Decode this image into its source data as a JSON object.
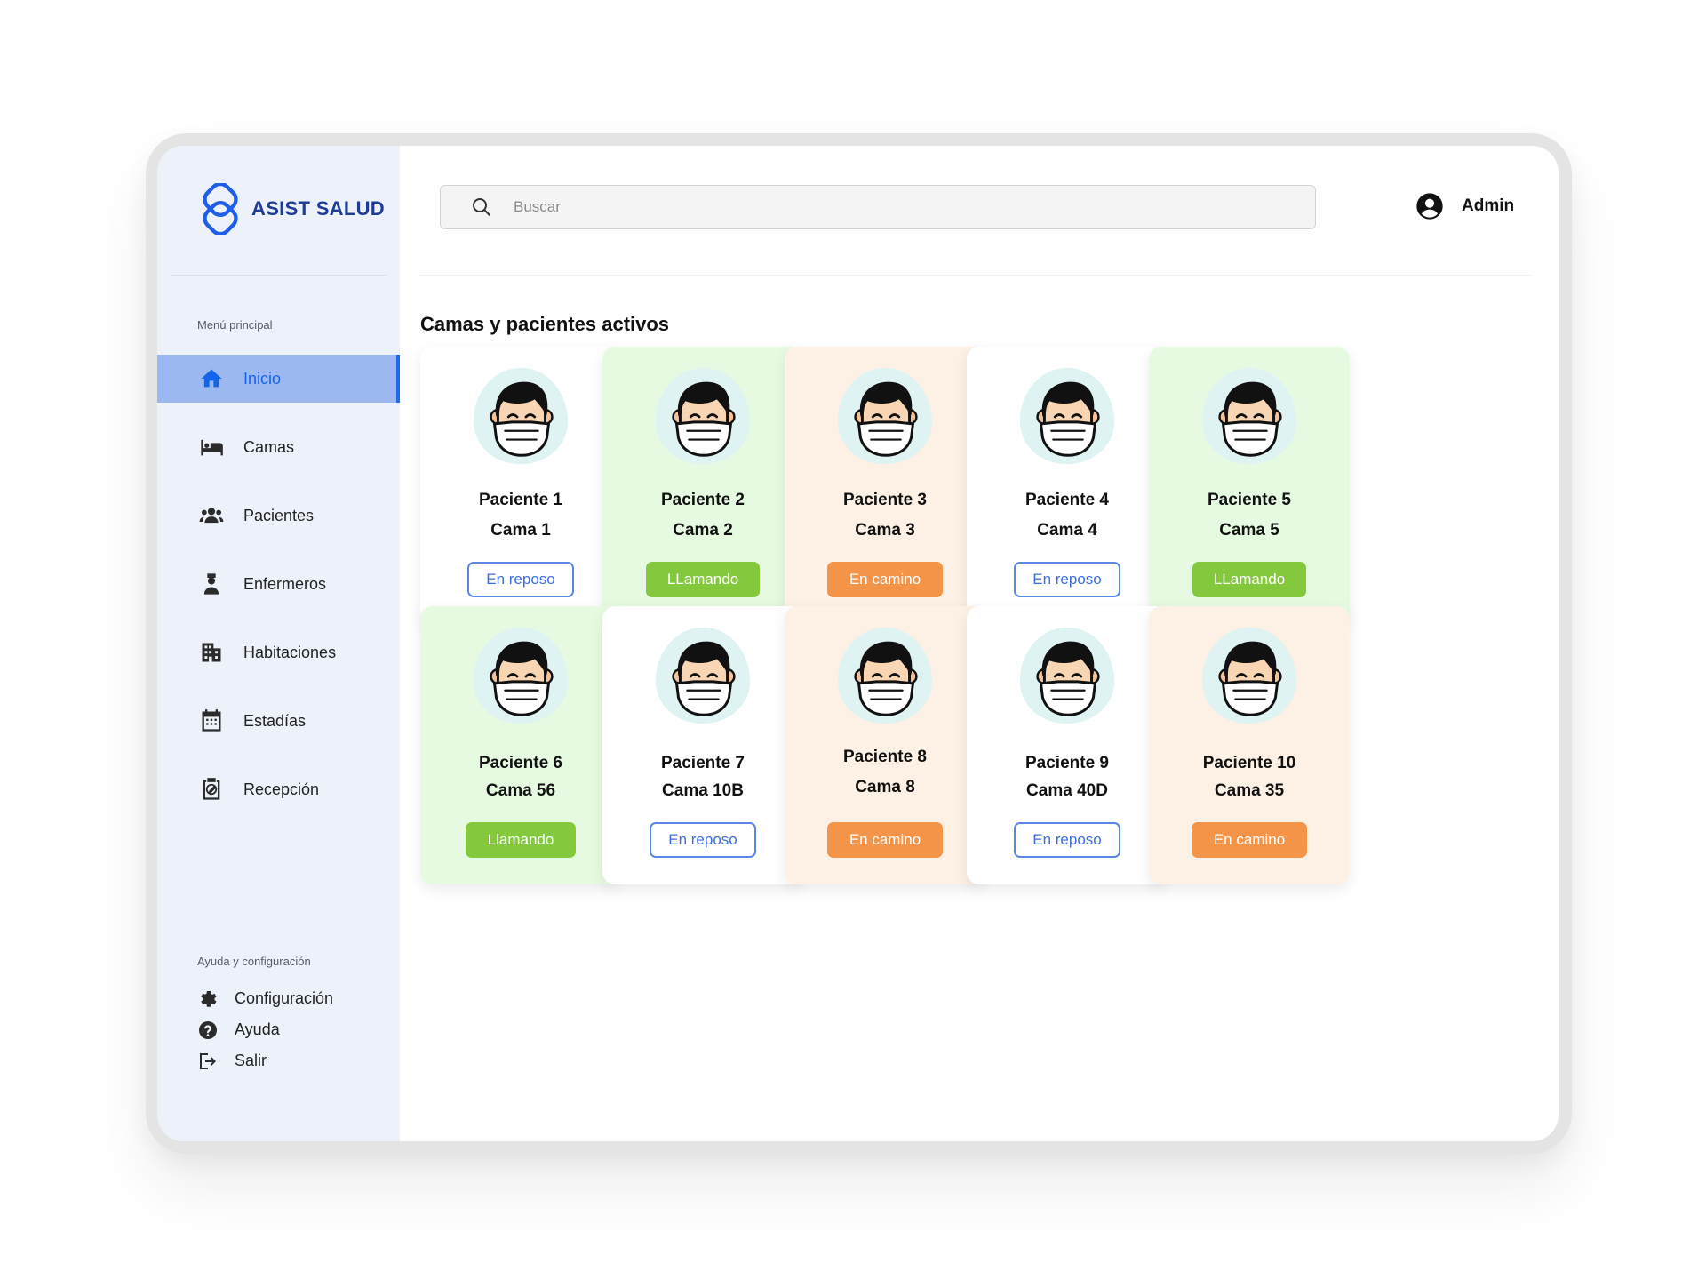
{
  "app": {
    "brand": "ASIST SALUD",
    "accent": "#1565e8"
  },
  "search": {
    "placeholder": "Buscar"
  },
  "user": {
    "name": "Admin"
  },
  "sidebar": {
    "menu_label": "Menú principal",
    "items": [
      {
        "label": "Inicio",
        "icon": "home-icon",
        "active": true
      },
      {
        "label": "Camas",
        "icon": "bed-icon"
      },
      {
        "label": "Pacientes",
        "icon": "users-icon"
      },
      {
        "label": "Enfermeros",
        "icon": "nurse-icon"
      },
      {
        "label": "Habitaciones",
        "icon": "building-icon"
      },
      {
        "label": "Estadías",
        "icon": "calendar-icon"
      },
      {
        "label": "Recepción",
        "icon": "clipboard-icon"
      }
    ],
    "help_label": "Ayuda y configuración",
    "help_items": [
      {
        "label": "Configuración",
        "icon": "gear-icon"
      },
      {
        "label": "Ayuda",
        "icon": "question-icon"
      },
      {
        "label": "Salir",
        "icon": "logout-icon"
      }
    ]
  },
  "main": {
    "title": "Camas y pacientes activos",
    "status_colors": {
      "En reposo": "#3d6fe0",
      "LLamando": "#84c93d",
      "Llamando": "#84c93d",
      "En camino": "#f39449"
    },
    "cards": [
      {
        "patient": "Paciente 1",
        "bed": "Cama 1",
        "status": "En reposo",
        "bg": "white"
      },
      {
        "patient": "Paciente 2",
        "bed": "Cama 2",
        "status": "LLamando",
        "bg": "green"
      },
      {
        "patient": "Paciente 3",
        "bed": "Cama 3",
        "status": "En camino",
        "bg": "orange"
      },
      {
        "patient": "Paciente 4",
        "bed": "Cama 4",
        "status": "En reposo",
        "bg": "white"
      },
      {
        "patient": "Paciente 5",
        "bed": "Cama 5",
        "status": "LLamando",
        "bg": "green"
      },
      {
        "patient": "Paciente 6",
        "bed": "Cama 56",
        "status": "Llamando",
        "bg": "green"
      },
      {
        "patient": "Paciente 7",
        "bed": "Cama 10B",
        "status": "En reposo",
        "bg": "white"
      },
      {
        "patient": "Paciente 8",
        "bed": "Cama 8",
        "status": "En camino",
        "bg": "orange"
      },
      {
        "patient": "Paciente 9",
        "bed": "Cama 40D",
        "status": "En reposo",
        "bg": "white"
      },
      {
        "patient": "Paciente 10",
        "bed": "Cama 35",
        "status": "En camino",
        "bg": "orange"
      }
    ]
  }
}
